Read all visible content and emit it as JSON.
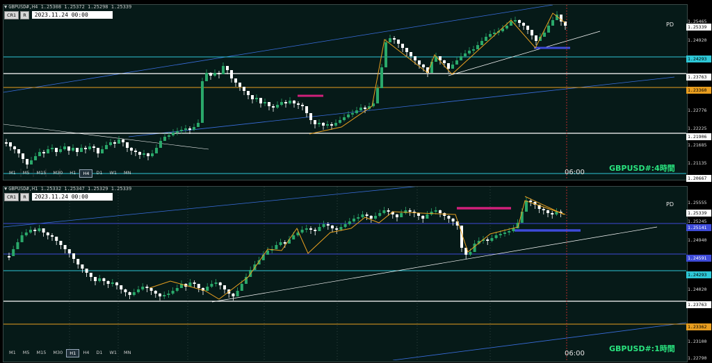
{
  "panels": [
    {
      "header": "GBPUSD#,H4  1.25308 1.25372 1.25298 1.25339",
      "toolbar": {
        "cr": "CR1",
        "r": "R",
        "date": "2023.11.24 00:00"
      },
      "price_labels": [
        {
          "text": "1.25465",
          "style": "plain"
        },
        {
          "text": "1.25339",
          "style": "box"
        },
        {
          "text": "1.24920",
          "style": "plain"
        },
        {
          "text": "1.24293",
          "style": "cyan"
        },
        {
          "text": "1.23763",
          "style": "box"
        },
        {
          "text": "1.23360",
          "style": "orange"
        },
        {
          "text": "1.22776",
          "style": "plain"
        },
        {
          "text": "1.22225",
          "style": "plain"
        },
        {
          "text": "1.21906",
          "style": "box"
        },
        {
          "text": "1.21685",
          "style": "plain"
        },
        {
          "text": "1.21135",
          "style": "plain"
        },
        {
          "text": "1.20667",
          "style": "box"
        }
      ],
      "timeframes": [
        "M1",
        "M5",
        "M15",
        "M30",
        "H1",
        "H4",
        "D1",
        "W1",
        "MN"
      ],
      "active_timeframe": "H4",
      "pd_label": "PD",
      "time_label": "06:00",
      "title": "GBPUSD#:4時間"
    },
    {
      "header": "GBPUSD#,H1  1.25332 1.25347 1.25329 1.25339",
      "toolbar": {
        "cr": "CR1",
        "r": "R",
        "date": "2023.11.24 00:00"
      },
      "price_labels": [
        {
          "text": "1.25555",
          "style": "plain"
        },
        {
          "text": "1.25339",
          "style": "box"
        },
        {
          "text": "1.25245",
          "style": "plain"
        },
        {
          "text": "1.25141",
          "style": "blue"
        },
        {
          "text": "1.24940",
          "style": "plain"
        },
        {
          "text": "1.24591",
          "style": "blue"
        },
        {
          "text": "1.24293",
          "style": "cyan"
        },
        {
          "text": "1.24020",
          "style": "plain"
        },
        {
          "text": "1.23763",
          "style": "box"
        },
        {
          "text": "1.23362",
          "style": "orange"
        },
        {
          "text": "1.23100",
          "style": "plain"
        },
        {
          "text": "1.22790",
          "style": "plain"
        }
      ],
      "timeframes": [
        "M1",
        "M5",
        "M15",
        "M30",
        "H1",
        "H4",
        "D1",
        "W1",
        "MN"
      ],
      "active_timeframe": "H1",
      "pd_label": "PD",
      "time_label": "06:00",
      "title": "GBPUSD#:1時間"
    }
  ],
  "colors": {
    "background": "#061a18",
    "bull_candle": "#2aa86a",
    "bear_candle": "#ffffff",
    "channel": "#3a6fe0",
    "trendline": "#ffffff",
    "level_white": "#ffffff",
    "level_cyan": "#2ec7d6",
    "level_orange": "#e89d1f",
    "level_blue": "#3e4bd8",
    "zigzag": "#e8a020",
    "magenta": "#d0207a",
    "title": "#29e27e",
    "vline": "#e03030"
  }
}
